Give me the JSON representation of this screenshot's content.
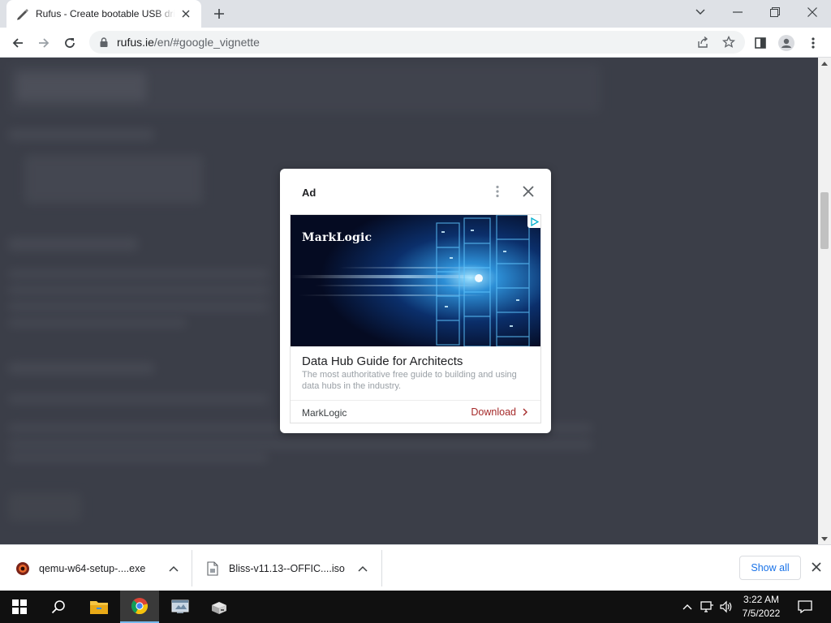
{
  "browser": {
    "tab": {
      "title": "Rufus - Create bootable USB drives the easy way",
      "favicon": "rufus-icon"
    },
    "url": {
      "host": "rufus.ie",
      "path": "/en/#google_vignette"
    }
  },
  "ad": {
    "label": "Ad",
    "brand_logo": "MarkLogic",
    "headline": "Data Hub Guide for Architects",
    "description": "The most authoritative free guide to building and using data hubs in the industry.",
    "advertiser": "MarkLogic",
    "cta": "Download",
    "cta_color": "#a52a2a"
  },
  "downloads": {
    "items": [
      {
        "name": "qemu-w64-setup-....exe",
        "icon": "qemu-icon"
      },
      {
        "name": "Bliss-v11.13--OFFIC....iso",
        "icon": "file-icon"
      }
    ],
    "show_all": "Show all"
  },
  "taskbar": {
    "time": "3:22 AM",
    "date": "7/5/2022",
    "accent": "#76b9ed"
  }
}
